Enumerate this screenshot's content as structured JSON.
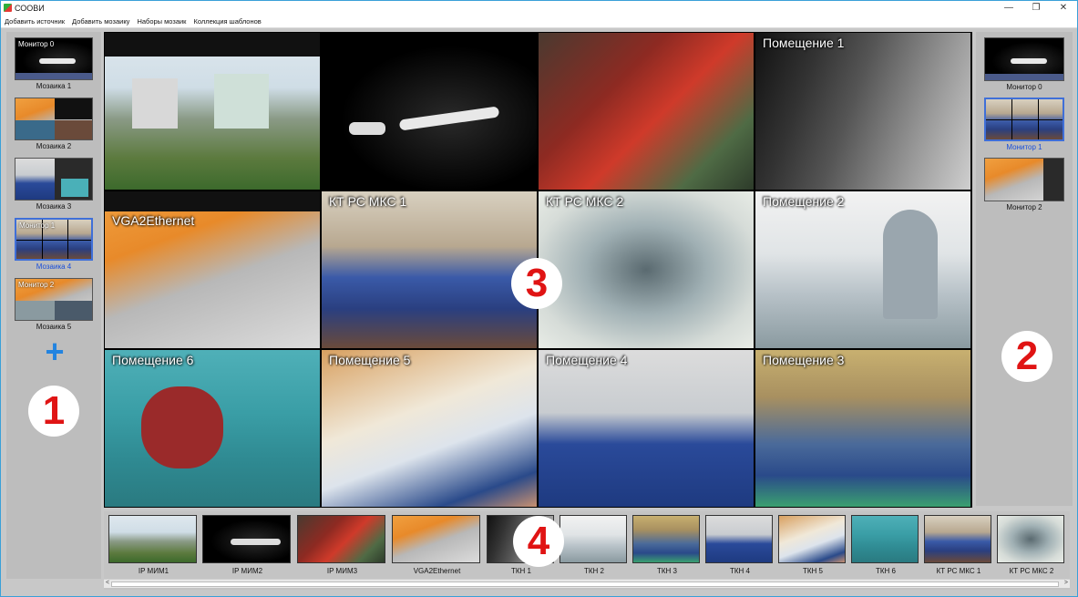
{
  "window": {
    "title": "СООВИ",
    "controls": {
      "minimize": "—",
      "restore": "❐",
      "close": "✕"
    }
  },
  "menu": [
    "Добавить источник",
    "Добавить мозаику",
    "Наборы мозаик",
    "Коллекция шаблонов"
  ],
  "mosaics": [
    {
      "label": "Мозаика 1",
      "monitor": "Монитор 0",
      "selected": false
    },
    {
      "label": "Мозаика 2",
      "monitor": "",
      "selected": false
    },
    {
      "label": "Мозаика 3",
      "monitor": "",
      "selected": false
    },
    {
      "label": "Мозаика 4",
      "monitor": "Монитор 1",
      "selected": true
    },
    {
      "label": "Мозаика 5",
      "monitor": "Монитор 2",
      "selected": false
    }
  ],
  "add_mosaic_symbol": "+",
  "monitors": [
    {
      "label": "Монитор 0",
      "selected": false
    },
    {
      "label": "Монитор 1",
      "selected": true
    },
    {
      "label": "Монитор 2",
      "selected": false
    }
  ],
  "grid_tiles": [
    {
      "label": "",
      "caption": ""
    },
    {
      "label": "",
      "caption": ""
    },
    {
      "label": "",
      "caption": ""
    },
    {
      "label": "Помещение 1",
      "caption": ""
    },
    {
      "label": "VGA2Ethernet",
      "caption": ""
    },
    {
      "label": "КТ РС МКС 1",
      "caption": ""
    },
    {
      "label": "КТ РС МКС 2",
      "caption": ""
    },
    {
      "label": "Помещение 2",
      "caption": ""
    },
    {
      "label": "Помещение 6",
      "caption": ""
    },
    {
      "label": "Помещение 5",
      "caption": ""
    },
    {
      "label": "Помещение 4",
      "caption": ""
    },
    {
      "label": "Помещение 3",
      "caption": ""
    }
  ],
  "sources": [
    "IP МИМ1",
    "IP МИМ2",
    "IP МИМ3",
    "VGA2Ethernet",
    "ТКН 1",
    "ТКН 2",
    "ТКН 3",
    "ТКН 4",
    "ТКН 5",
    "ТКН 6",
    "КТ РС МКС 1",
    "КТ РС МКС 2"
  ],
  "callouts": [
    "1",
    "2",
    "3",
    "4"
  ],
  "scroll": {
    "left": "<",
    "right": ">"
  },
  "colors": {
    "accent": "#1b4fd8",
    "selection_border": "#3f6fd8",
    "add_button": "#2384e0",
    "callout_number": "#e01414"
  }
}
